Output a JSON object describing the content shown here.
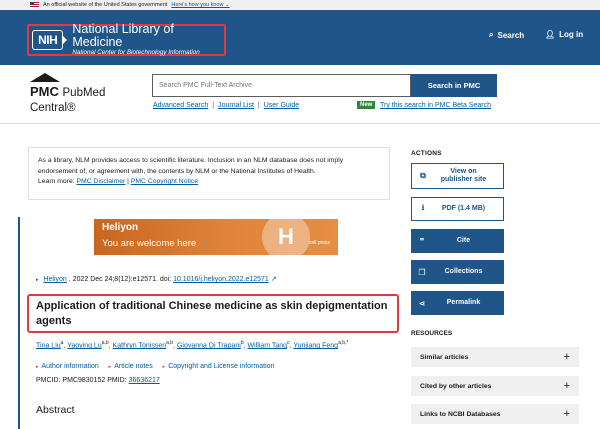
{
  "gov_banner": {
    "text": "An official website of the United States government",
    "link": "Here's how you know ⌄"
  },
  "header": {
    "logo_badge": "NIH",
    "title": "National Library of Medicine",
    "subtitle": "National Center for Biotechnology Information",
    "search_label": "Search",
    "login_label": "Log in"
  },
  "pmc": {
    "logo_pmc": "PMC",
    "logo_rest": "PubMed Central®",
    "search_placeholder": "Search PMC Full-Text Archive",
    "search_button": "Search in PMC",
    "links": [
      "Advanced Search",
      "Journal List",
      "User Guide"
    ],
    "new_badge": "New",
    "beta_link": "Try this search in PMC Beta Search"
  },
  "disclaimer": {
    "text": "As a library, NLM provides access to scientific literature. Inclusion in an NLM database does not imply endorsement of, or agreement with, the contents by NLM or the National Institutes of Health.",
    "learn_more": "Learn more:",
    "link1": "PMC Disclaimer",
    "sep": "|",
    "link2": "PMC Copyright Notice"
  },
  "ad": {
    "title": "Heliyon",
    "tagline": "You are welcome here",
    "mark": "H",
    "mini": "cell press"
  },
  "article": {
    "journal": "Heliyon",
    "citation": ". 2022 Dec 24;8(12):e12571. doi: ",
    "doi": "10.1016/j.heliyon.2022.e12571",
    "title": "Application of traditional Chinese medicine as skin depigmentation agents",
    "authors": [
      {
        "name": "Tina Liu",
        "sup": "a"
      },
      {
        "name": "Yaoying Lu",
        "sup": "a,b"
      },
      {
        "name": "Kathryn Tonissen",
        "sup": "a,b"
      },
      {
        "name": "Giovanna Di Trapani",
        "sup": "b"
      },
      {
        "name": "William Tang",
        "sup": "c"
      },
      {
        "name": "Yunjiang Feng",
        "sup": "a,b,*"
      }
    ],
    "meta_links": [
      "Author information",
      "Article notes",
      "Copyright and License information"
    ],
    "pmcid": "PMCID: PMC9830152",
    "pmid_label": "PMID:",
    "pmid": "36636217",
    "abstract_heading": "Abstract"
  },
  "sidebar": {
    "actions_label": "ACTIONS",
    "actions": [
      {
        "label": "View on publisher site",
        "icon": "external-link-icon"
      },
      {
        "label": "PDF (1.4 MB)",
        "icon": "download-icon"
      },
      {
        "label": "Cite",
        "icon": "quote-icon"
      },
      {
        "label": "Collections",
        "icon": "collections-icon"
      },
      {
        "label": "Permalink",
        "icon": "share-icon"
      }
    ],
    "resources_label": "RESOURCES",
    "resources": [
      "Similar articles",
      "Cited by other articles",
      "Links to NCBI Databases"
    ]
  },
  "colors": {
    "nih_blue": "#20558a",
    "link_blue": "#005ea2",
    "highlight_red": "#e0393e",
    "new_green": "#2e8540"
  }
}
